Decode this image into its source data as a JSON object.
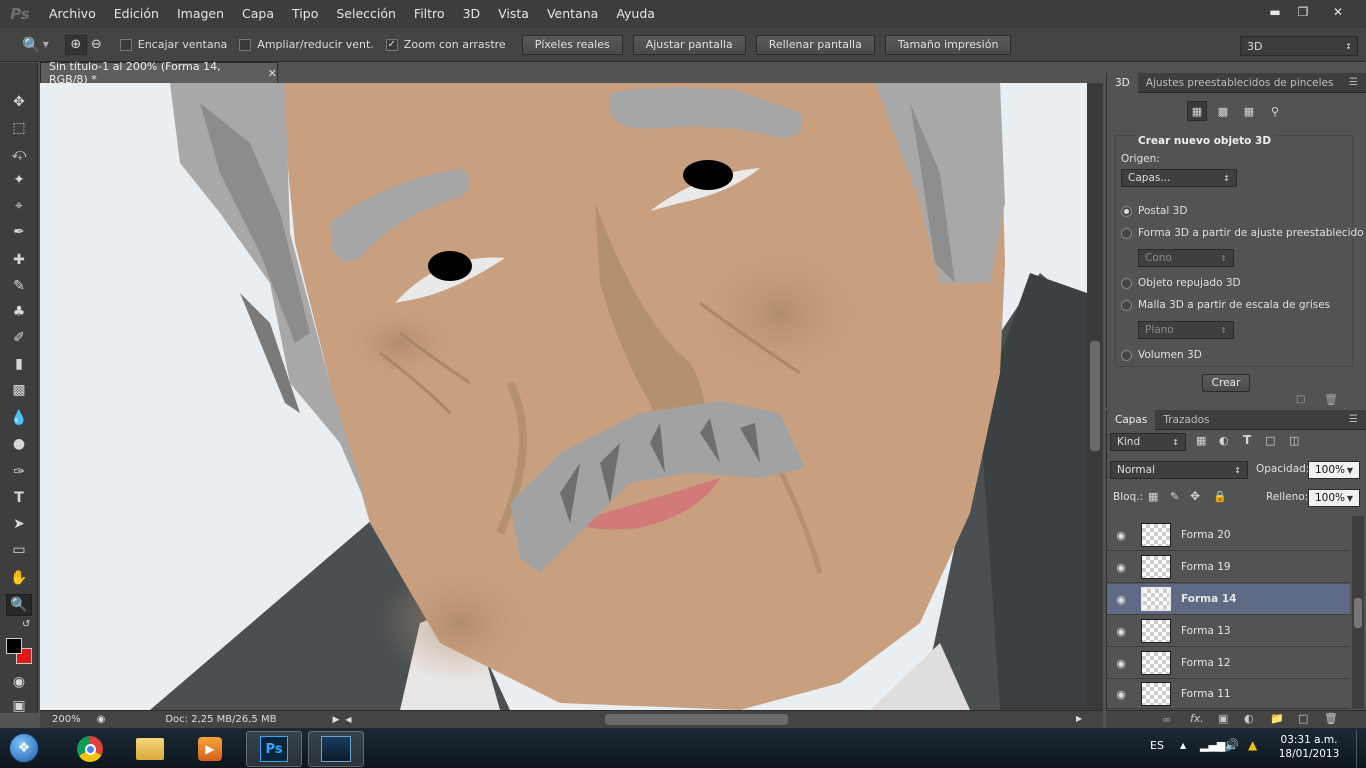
{
  "menu": {
    "logo": "Ps",
    "items": [
      "Archivo",
      "Edición",
      "Imagen",
      "Capa",
      "Tipo",
      "Selección",
      "Filtro",
      "3D",
      "Vista",
      "Ventana",
      "Ayuda"
    ]
  },
  "options": {
    "encajar": "Encajar ventana",
    "ampliar": "Ampliar/reducir vent.",
    "zoom_arrastre": "Zoom con arrastre",
    "btn_pixeles": "Píxeles reales",
    "btn_ajustar": "Ajustar pantalla",
    "btn_rellenar": "Rellenar pantalla",
    "btn_tamano": "Tamaño impresión",
    "workspace": "3D"
  },
  "document": {
    "tab_title": "Sin título-1 al 200% (Forma 14, RGB/8) *",
    "zoom": "200%",
    "doc_info": "Doc: 2,25 MB/26,5 MB"
  },
  "panel3d": {
    "tab_3d": "3D",
    "tab_presets": "Ajustes preestablecidos de pinceles",
    "heading": "Crear nuevo objeto 3D",
    "origen_label": "Origen:",
    "origen_value": "Capas...",
    "options": [
      "Postal 3D",
      "Forma 3D a partir de ajuste preestablecido",
      "Objeto repujado 3D",
      "Malla 3D a partir de escala de grises",
      "Volumen 3D"
    ],
    "cono": "Cono",
    "plano": "Plano",
    "crear": "Crear"
  },
  "layers_panel": {
    "tab_capas": "Capas",
    "tab_trazados": "Trazados",
    "kind": "Kind",
    "blend": "Normal",
    "opacity_label": "Opacidad:",
    "opacity": "100%",
    "lock_label": "Bloq.:",
    "fill_label": "Relleno:",
    "fill": "100%",
    "layers": [
      "Forma 20",
      "Forma 19",
      "Forma 14",
      "Forma 13",
      "Forma 12",
      "Forma 11"
    ]
  },
  "taskbar": {
    "lang": "ES",
    "time": "03:31 a.m.",
    "date": "18/01/2013"
  },
  "colors": {
    "skin": "#c9a07f",
    "hair": "#a8a8a8",
    "coat": "#4a4f52",
    "selected_layer": "#5f6b85",
    "background_color": "#e01515"
  }
}
